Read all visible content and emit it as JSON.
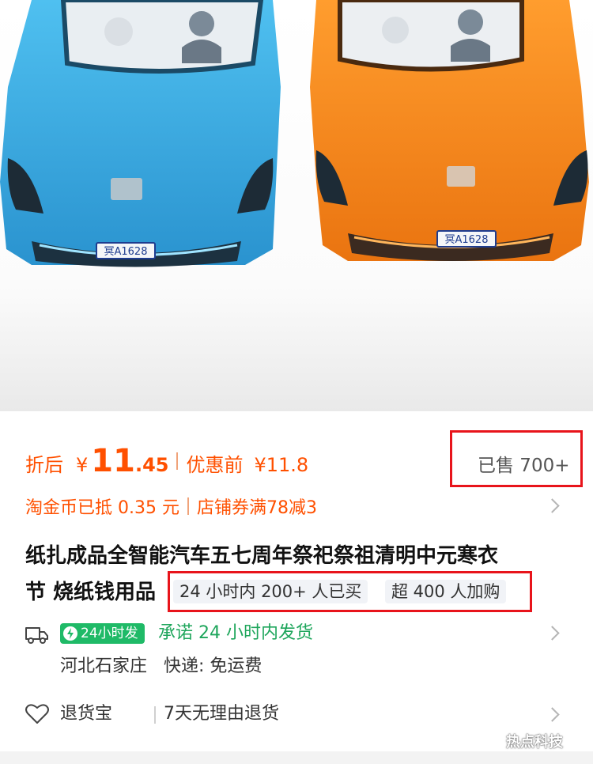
{
  "product_images": {
    "cars": [
      {
        "color": "#35a8e0",
        "plate": "冥A1628"
      },
      {
        "color": "#f4891f",
        "plate": "冥A1628"
      }
    ]
  },
  "price": {
    "after_label": "折后",
    "currency": "¥",
    "after_int": "11",
    "after_dec": ".45",
    "before_label": "优惠前",
    "before_value": "¥11.8",
    "accent_color": "#ff5000"
  },
  "sold": {
    "text": "已售 700+"
  },
  "coupons": {
    "coin": "淘金币已抵 0.35 元",
    "store": "店铺券满78减3"
  },
  "product": {
    "title_line1": "纸扎成品全智能汽车五七周年祭祀祭祖清明中元寒衣",
    "title_line2": "节 烧纸钱用品",
    "tags": [
      "24 小时内 200+ 人已买",
      "超 400 人加购"
    ]
  },
  "shipping": {
    "badge": "24小时发",
    "promise": "承诺 24 小时内发货",
    "location": "河北石家庄",
    "carrier": "快递: 免运费",
    "badge_color": "#1fba67"
  },
  "returns": {
    "label": "退货宝",
    "desc": "7天无理由退货"
  },
  "highlight_color": "#e8141b",
  "watermark": "热点科技"
}
